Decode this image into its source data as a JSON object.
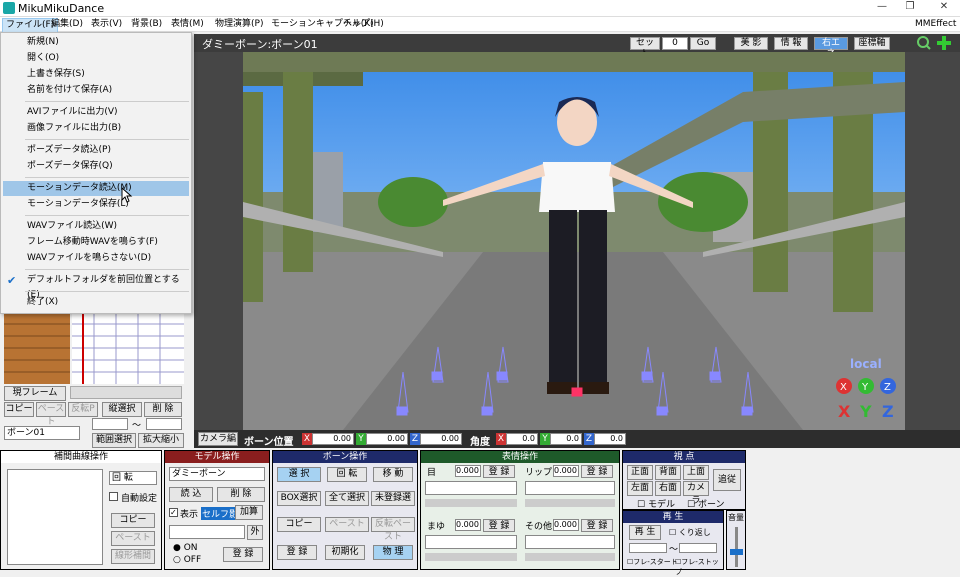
{
  "window": {
    "title": "MikuMikuDance",
    "minimize": "—",
    "restore": "❐",
    "close": "✕"
  },
  "menu": {
    "items": [
      "ファイル(F)",
      "編集(D)",
      "表示(V)",
      "背景(B)",
      "表情(M)",
      "物理演算(P)",
      "モーションキャプチャ(K)",
      "ヘルプ(H)"
    ],
    "right": "MMEffect"
  },
  "file_menu": {
    "items": [
      "新規(N)",
      "開く(O)",
      "上書き保存(S)",
      "名前を付けて保存(A)",
      "AVIファイルに出力(V)",
      "画像ファイルに出力(B)",
      "ポーズデータ読込(P)",
      "ポーズデータ保存(Q)",
      "モーションデータ読込(M)",
      "モーションデータ保存(L)",
      "WAVファイル読込(W)",
      "フレーム移動時WAVを鳴らす(F)",
      "WAVファイルを鳴らさない(D)",
      "デフォルトフォルダを前回位置とする(E)",
      "終了(X)"
    ],
    "highlighted": "モーションデータ読込(M)",
    "checked": "デフォルトフォルダを前回位置とする(E)"
  },
  "viewport": {
    "bone_title": "ダミーボーン:ボーン01",
    "set_label": "セット",
    "frame_value": "0",
    "go_label": "Go",
    "buttons": [
      "美 影",
      "情 報",
      "右エネ",
      "座標軸"
    ],
    "local_label": "local"
  },
  "left": {
    "frame_label": "現フレーム",
    "copy": "コピー",
    "paste": "ペースト",
    "reverse_paste": "反転P",
    "vertical_select": "縦選択",
    "delete": "削 除",
    "bone_select": "ボーン01",
    "range_select": "範囲選択",
    "scale": "拡大縮小",
    "tilde": "～"
  },
  "camera": {
    "edit": "カメラ編",
    "pos_label": "ボーン位置",
    "angle_label": "角度",
    "x": "0.00",
    "y": "0.00",
    "z": "0.00",
    "ax": "0.0",
    "ay": "0.0",
    "az": "0.0"
  },
  "interp": {
    "title": "補間曲線操作",
    "rotate": "回 転",
    "auto": "自動設定",
    "copy": "コピー",
    "paste": "ペースト",
    "linear": "線形補間"
  },
  "model": {
    "title": "モデル操作",
    "model_select": "ダミーボーン",
    "load": "読 込",
    "delete": "削 除",
    "show": "表示",
    "self_shadow": "セルフ影",
    "add": "加算",
    "outside": "外",
    "on": "ON",
    "off": "OFF",
    "register": "登 録"
  },
  "bone": {
    "title": "ボーン操作",
    "select": "選 択",
    "rotate": "回 転",
    "move": "移 動",
    "box_select": "BOX選択",
    "select_all": "全て選択",
    "unreg_select": "未登録選",
    "copy": "コピー",
    "paste": "ペースト",
    "reverse_paste": "反転ペースト",
    "register": "登 録",
    "init": "初期化",
    "physics": "物 理"
  },
  "expr": {
    "title": "表情操作",
    "eye": "目",
    "lip": "リップ",
    "brow": "まゆ",
    "other": "その他",
    "value": "0.000",
    "register": "登 録"
  },
  "view": {
    "title": "視 点",
    "front": "正面",
    "back": "背面",
    "top": "上面",
    "left": "左面",
    "right": "右面",
    "camera": "カメラ",
    "follow": "追従",
    "model": "モデル",
    "bone": "ボーン"
  },
  "play": {
    "title": "再 生",
    "play": "再 生",
    "repeat": "くり返し",
    "frame_start": "フレ-スタート",
    "frame_stop": "フレ-ストップ",
    "volume": "音量",
    "tilde": "～"
  }
}
